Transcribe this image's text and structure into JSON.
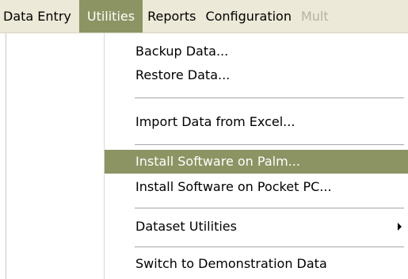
{
  "menubar": {
    "items": [
      {
        "label": "Data Entry",
        "state": "normal"
      },
      {
        "label": "Utilities",
        "state": "active"
      },
      {
        "label": "Reports",
        "state": "normal"
      },
      {
        "label": "Configuration",
        "state": "normal"
      },
      {
        "label": "Mult",
        "state": "disabled"
      }
    ]
  },
  "utilities_menu": {
    "items": [
      {
        "label": "Backup Data..."
      },
      {
        "label": "Restore Data..."
      },
      {
        "label": "Import Data from Excel..."
      },
      {
        "label": "Install Software on Palm...",
        "highlighted": true
      },
      {
        "label": "Install Software on Pocket PC..."
      },
      {
        "label": "Dataset Utilities",
        "submenu_icon": "submenu-arrow-icon"
      },
      {
        "label": "Switch to Demonstration Data"
      }
    ]
  },
  "colors": {
    "menubar_background": "#ece9d8",
    "highlight_background": "#8c9463",
    "highlight_text": "#ffffff",
    "disabled_text": "#b5b29f"
  }
}
